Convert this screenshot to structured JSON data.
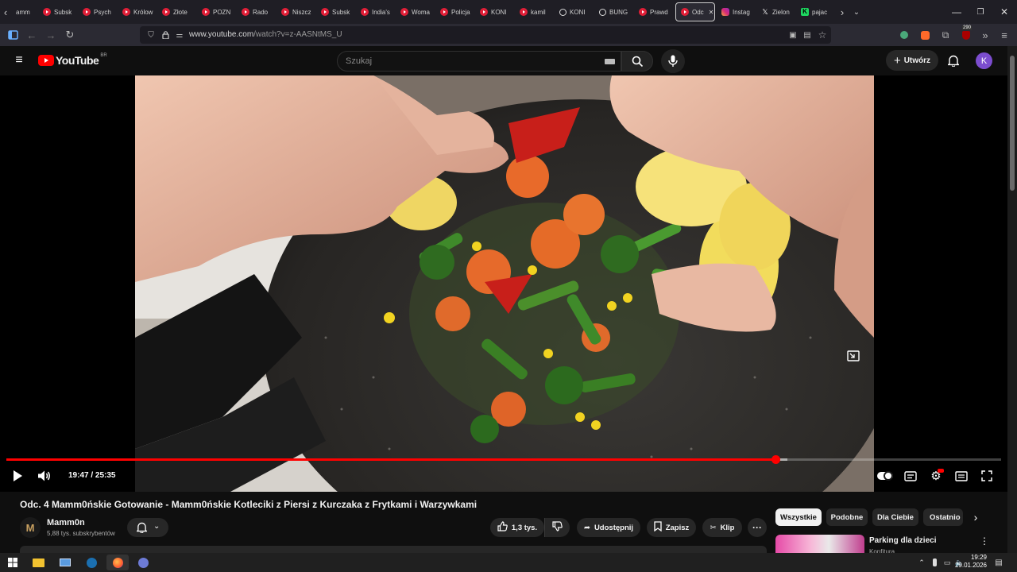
{
  "browser": {
    "tabs": [
      {
        "label": "amm",
        "kind": "nav"
      },
      {
        "label": "Subsk",
        "kind": "yt"
      },
      {
        "label": "Psych",
        "kind": "yt"
      },
      {
        "label": "Królow",
        "kind": "yt"
      },
      {
        "label": "Złote",
        "kind": "yt"
      },
      {
        "label": "POZN",
        "kind": "yt"
      },
      {
        "label": "Rado",
        "kind": "yt"
      },
      {
        "label": "Niszcz",
        "kind": "yt"
      },
      {
        "label": "Subsk",
        "kind": "yt"
      },
      {
        "label": "India's",
        "kind": "yt"
      },
      {
        "label": "Woma",
        "kind": "yt"
      },
      {
        "label": "Policja",
        "kind": "yt"
      },
      {
        "label": "KONI",
        "kind": "yt"
      },
      {
        "label": "kamil",
        "kind": "yt"
      },
      {
        "label": "KONI",
        "kind": "other"
      },
      {
        "label": "BUNG",
        "kind": "other"
      },
      {
        "label": "Prawd",
        "kind": "yt"
      },
      {
        "label": "Odc",
        "kind": "active"
      },
      {
        "label": "Instag",
        "kind": "insta"
      },
      {
        "label": "Zielon",
        "kind": "x"
      },
      {
        "label": "pajac",
        "kind": "k"
      }
    ],
    "url_host": "www.youtube.com",
    "url_path": "/watch?v=z-AASNtMS_U",
    "extension_badge": "290"
  },
  "youtube": {
    "logo_text": "YouTube",
    "logo_country": "BR",
    "search_placeholder": "Szukaj",
    "create_label": "Utwórz",
    "avatar_letter": "K"
  },
  "player": {
    "time_current": "19:47",
    "time_total": "25:35",
    "time_display": "19:47 / 25:35",
    "progress_fraction": 0.773,
    "buffer_fraction": 0.785
  },
  "video": {
    "title": "Odc. 4 Mamm0ńskie Gotowanie - Mamm0ńskie Kotleciki z Piersi z Kurczaka z Frytkami i Warzywkami",
    "channel_name": "Mamm0n",
    "channel_avatar": "M",
    "subscribers": "5,88 tys. subskrybentów",
    "likes": "1,3 tys.",
    "share_label": "Udostępnij",
    "save_label": "Zapisz",
    "clip_label": "Klip"
  },
  "sidebar": {
    "chips": [
      "Wszystkie",
      "Podobne",
      "Dla Ciebie",
      "Ostatnio"
    ],
    "recommendation": {
      "title": "Parking dla dzieci",
      "channel": "Konfitura"
    }
  },
  "taskbar": {
    "time": "19:29",
    "date": "29.01.2026"
  }
}
